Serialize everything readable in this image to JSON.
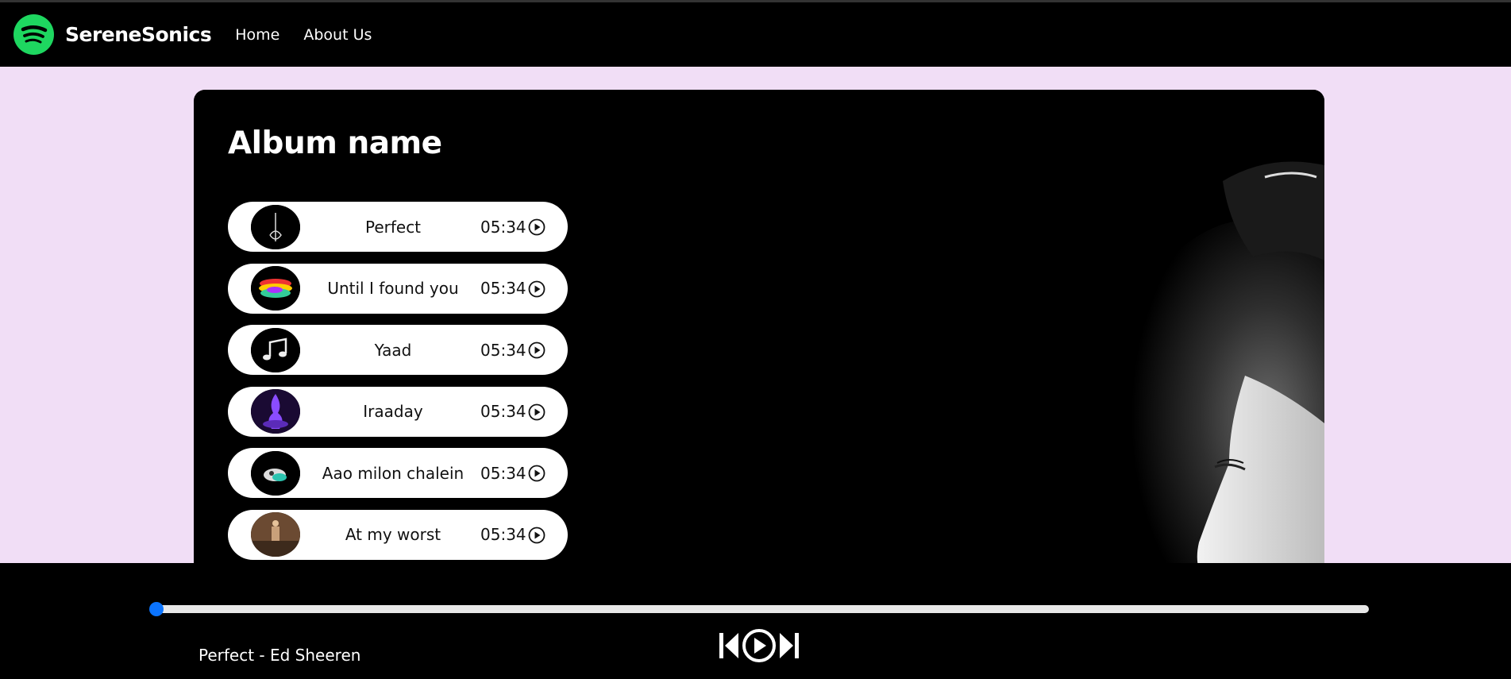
{
  "nav": {
    "brand": "SereneSonics",
    "links": [
      "Home",
      "About Us"
    ]
  },
  "album": {
    "title": "Album name",
    "songs": [
      {
        "name": "Perfect",
        "time": "05:34"
      },
      {
        "name": "Until I found you",
        "time": "05:34"
      },
      {
        "name": "Yaad",
        "time": "05:34"
      },
      {
        "name": "Iraaday",
        "time": "05:34"
      },
      {
        "name": "Aao milon chalein",
        "time": "05:34"
      },
      {
        "name": "At my worst",
        "time": "05:34"
      }
    ]
  },
  "player": {
    "now_playing": "Perfect - Ed Sheeren",
    "progress": 0.0
  },
  "icons": {
    "logo": "spotify-logo-icon",
    "song_play": "play-circle-icon",
    "prev": "skip-previous-icon",
    "play": "play-circle-icon",
    "next": "skip-next-icon"
  },
  "colors": {
    "brand": "#1ed760",
    "page_bg": "#f1def6",
    "accent": "#0b74ff"
  }
}
